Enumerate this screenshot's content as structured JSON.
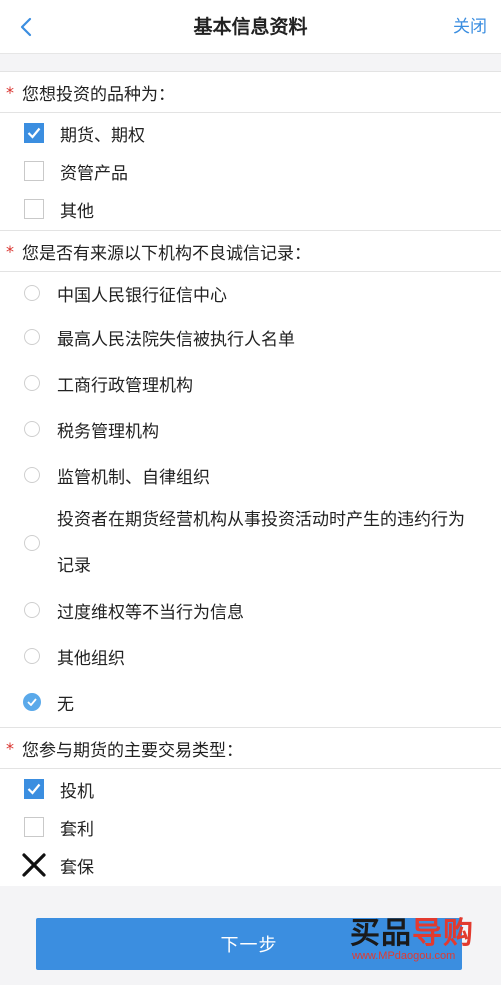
{
  "nav": {
    "title": "基本信息资料",
    "close_label": "关闭"
  },
  "q1": {
    "title": "您想投资的品种为：",
    "options": [
      {
        "label": "期货、期权",
        "checked": true
      },
      {
        "label": "资管产品",
        "checked": false
      },
      {
        "label": "其他",
        "checked": false
      }
    ]
  },
  "q2": {
    "title": "您是否有来源以下机构不良诚信记录：",
    "options": [
      {
        "label": "中国人民银行征信中心",
        "selected": false
      },
      {
        "label": "最高人民法院失信被执行人名单",
        "selected": false
      },
      {
        "label": "工商行政管理机构",
        "selected": false
      },
      {
        "label": "税务管理机构",
        "selected": false
      },
      {
        "label": "监管机制、自律组织",
        "selected": false
      },
      {
        "label_line1": "投资者在期货经营机构从事投资活动时产生的违约行为",
        "label_line2": "记录",
        "selected": false
      },
      {
        "label": "过度维权等不当行为信息",
        "selected": false
      },
      {
        "label": "其他组织",
        "selected": false
      },
      {
        "label": "无",
        "selected": true
      }
    ]
  },
  "q3": {
    "title": "您参与期货的主要交易类型：",
    "options": [
      {
        "label": "投机",
        "state": "checked"
      },
      {
        "label": "套利",
        "state": "unchecked"
      },
      {
        "label": "套保",
        "state": "crossed"
      }
    ]
  },
  "next_label": "下一步",
  "watermark": {
    "brand_part1": "买品",
    "brand_part2": "导购",
    "url": "www.MPdaogou.com"
  },
  "colors": {
    "accent": "#3b8ee0",
    "required_star": "#d9302b"
  },
  "icons": {
    "back": "chevron-left-icon",
    "check": "checkmark-icon",
    "cross": "cross-icon"
  }
}
